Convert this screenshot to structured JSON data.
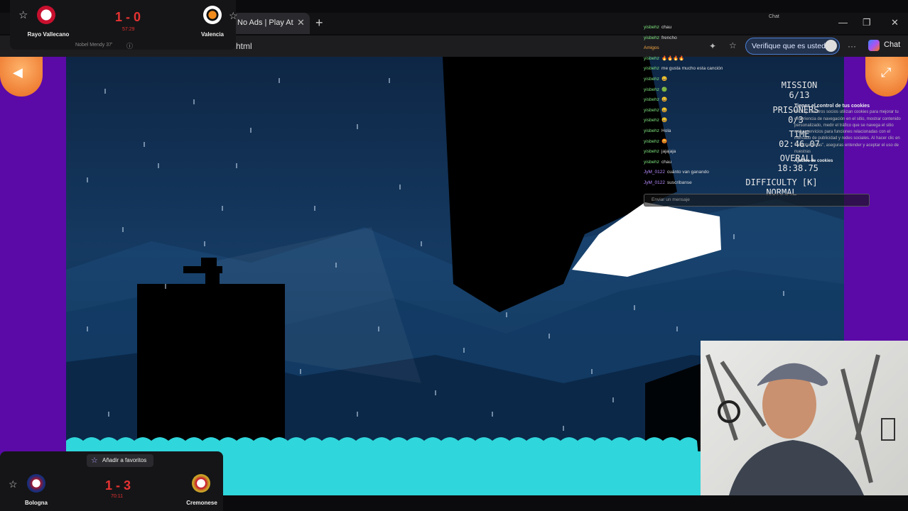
{
  "browser": {
    "tab_title": "No Ads | Play At",
    "tab_close": "✕",
    "new_tab": "+",
    "url_fragment": "html",
    "verify_label": "Verifique que es usted",
    "chat_label": "Chat",
    "chat_small_label": "Chat",
    "more_icon": "···",
    "window_controls": [
      "—",
      "❐",
      "✕"
    ]
  },
  "game": {
    "hud": {
      "mission_label": "MISSION",
      "mission_value": "6/13",
      "prisoners_label": "PRISONERS",
      "prisoners_value": "0/3",
      "time_label": "TIME",
      "time_value": "02:46.07",
      "overall_label": "OVERALL",
      "overall_value": "18:38.75",
      "difficulty_label": "DIFFICULTY [K]",
      "difficulty_value": "NORMAL"
    },
    "nav": {
      "back_icon": "◀",
      "fullscreen_icon": "⤢"
    }
  },
  "chat": {
    "lines": [
      {
        "user": "yisbehz",
        "text": "chau",
        "color": "green"
      },
      {
        "user": "yisbehz",
        "text": "frencho",
        "color": "green"
      },
      {
        "user": "",
        "text": "Amigos",
        "color": "orange"
      },
      {
        "user": "yisbehz",
        "text": "🔥🔥🔥🔥",
        "color": "green"
      },
      {
        "user": "yisbehz",
        "text": "me gusta mucho esta canción",
        "color": "green"
      },
      {
        "user": "yisbehz",
        "text": "😀",
        "color": "green"
      },
      {
        "user": "yisbehz",
        "text": "🟢",
        "color": "green"
      },
      {
        "user": "yisbehz",
        "text": "😀",
        "color": "green"
      },
      {
        "user": "yisbehz",
        "text": "😀",
        "color": "green"
      },
      {
        "user": "yisbehz",
        "text": "😀",
        "color": "green"
      },
      {
        "user": "yisbehz",
        "text": "Hola",
        "color": "green"
      },
      {
        "user": "yisbehz",
        "text": "😡",
        "color": "green"
      },
      {
        "user": "yisbehz",
        "text": "jajajaja",
        "color": "green"
      },
      {
        "user": "yisbehz",
        "text": "chau",
        "color": "green"
      },
      {
        "user": "JyM_0122",
        "text": "cuánto van ganando",
        "color": "purple"
      },
      {
        "user": "JyM_0122",
        "text": "suscribanse",
        "color": "purple"
      }
    ],
    "input_placeholder": "Enviar un mensaje"
  },
  "cookies": {
    "title": "Tienes el control de tus cookies",
    "body": "KICK y nuestros socios utilizan cookies para mejorar tu experiencia de navegación en el sitio, mostrar contenido personalizado, medir el tráfico que se navega el sitio web y servicios para funciones relacionadas con el mercado de publicidad y redes sociales. Al hacer clic en \"Aceptar todas\", aseguras entender y aceptar el uso de nuestras",
    "settings_label": "Ajustes de cookies"
  },
  "scores": {
    "top": {
      "home": "Rayo Vallecano",
      "away": "Valencia",
      "score": "1 - 0",
      "minute": "57:29",
      "scorer": "Nobel Mendy 37'"
    },
    "bottom": {
      "home": "Bologna",
      "away": "Cremonese",
      "score": "1 - 3",
      "minute": "70:11",
      "favorite_label": "Añadir a favoritos"
    }
  },
  "colors": {
    "page_purple": "#5b0aa8",
    "water": "#2fd6db",
    "score_red": "#e63232",
    "accent_blue": "#4a7fd6"
  }
}
